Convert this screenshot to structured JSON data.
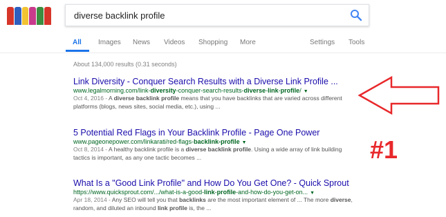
{
  "logo": {
    "label": "Google Doodle",
    "colors": [
      "#d6352a",
      "#2e5fbf",
      "#f1c232",
      "#c83a8c",
      "#3b8d3f",
      "#d6352a"
    ]
  },
  "search": {
    "query": "diverse backlink profile"
  },
  "tabs": {
    "all": "All",
    "images": "Images",
    "news": "News",
    "videos": "Videos",
    "shopping": "Shopping",
    "more": "More",
    "settings": "Settings",
    "tools": "Tools"
  },
  "stats": "About 134,000 results (0.31 seconds)",
  "results": [
    {
      "title": "Link Diversity - Conquer Search Results with a Diverse Link Profile ...",
      "url_parts": [
        "www.legalmorning.com/link-",
        "diversity",
        "-conquer-search-results-",
        "diverse",
        "-",
        "link",
        "-",
        "profile",
        "/"
      ],
      "date": "Oct 4, 2016 - ",
      "snippet_parts": [
        "A ",
        "diverse backlink profile",
        " means that you have backlinks that are varied across different platforms (blogs, news sites, social media, etc.), using ..."
      ]
    },
    {
      "title": "5 Potential Red Flags in Your Backlink Profile - Page One Power",
      "url_parts": [
        "www.pageonepower.com/linkarati/red-flags-",
        "backlink-profile",
        ""
      ],
      "date": "Oct 8, 2014 - ",
      "snippet_parts": [
        "A healthy backlink profile is a ",
        "diverse backlink profile",
        ". Using a wide array of link building tactics is important, as any one tactic becomes ..."
      ]
    },
    {
      "title": "What Is a \"Good Link Profile\" and How Do You Get One? - Quick Sprout",
      "url_parts": [
        "https://www.quicksprout.com/.../what-is-a-good-",
        "link",
        "-",
        "profile",
        "-and-how-do-you-get-on..."
      ],
      "date": "Apr 18, 2014 - ",
      "snippet_parts": [
        "Any SEO will tell you that ",
        "backlinks",
        " are the most important element of ... The more ",
        "diverse",
        ", random, and diluted an inbound ",
        "link profile",
        " is, the ..."
      ]
    }
  ],
  "annotation": {
    "badge": "#1",
    "color": "#e8282b"
  },
  "accent": "#1a73e8"
}
